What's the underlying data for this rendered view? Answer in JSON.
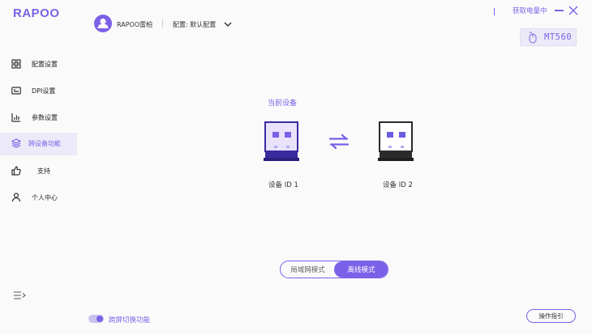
{
  "app": {
    "logo": "RAPOO"
  },
  "sidebar": {
    "items": [
      {
        "label": "配置设置",
        "icon": "grid-icon"
      },
      {
        "label": "DPI设置",
        "icon": "dpi-icon"
      },
      {
        "label": "参数设置",
        "icon": "chart-icon"
      },
      {
        "label": "跨设备功能",
        "icon": "layers-icon",
        "active": true
      },
      {
        "label": "支持",
        "icon": "thumbs-up-icon"
      },
      {
        "label": "个人中心",
        "icon": "person-icon"
      }
    ]
  },
  "header": {
    "user_name": "RAPOO雷柏",
    "config_label": "配置: 默认配置",
    "battery_link": "获取电量中",
    "model_name": "MT560"
  },
  "main": {
    "current_device_title": "当前设备",
    "device_1_label": "设备 ID 1",
    "device_2_label": "设备 ID 2",
    "mode_toggle": {
      "lan": "局域网模式",
      "offline": "离线模式",
      "selected": "offline"
    }
  },
  "footer": {
    "switch_label": "跨屏切换功能",
    "switch_on": true,
    "guide_button": "操作指引"
  },
  "colors": {
    "accent": "#7b61e8",
    "accent_light": "#ece9f8",
    "dark": "#2b2b2b",
    "background": "#fafafa"
  }
}
